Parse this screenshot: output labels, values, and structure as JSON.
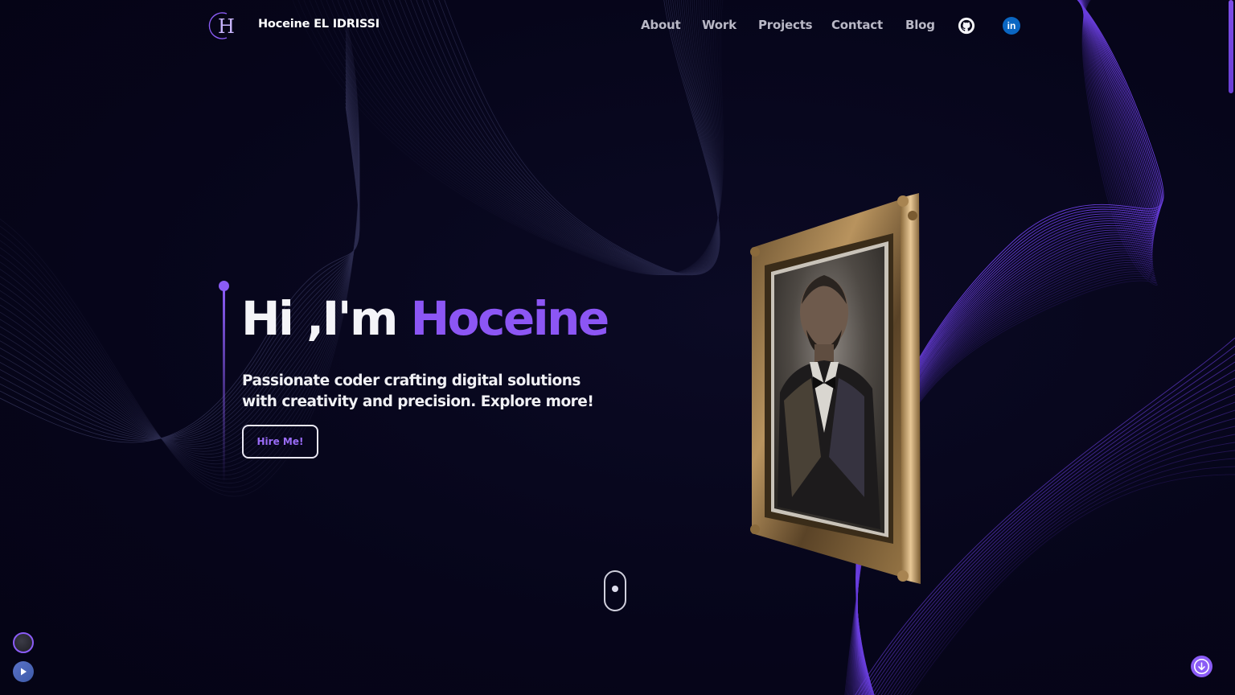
{
  "header": {
    "logo_letter": "H",
    "brand_name": "Hoceine EL IDRISSI",
    "nav": [
      {
        "label": "About"
      },
      {
        "label": "Work"
      },
      {
        "label": "Projects"
      },
      {
        "label": "Contact"
      },
      {
        "label": "Blog"
      }
    ],
    "social": [
      {
        "icon": "github-icon"
      },
      {
        "icon": "linkedin-icon",
        "text": "in"
      }
    ]
  },
  "hero": {
    "greeting": "Hi ,I'm ",
    "name": "Hoceine",
    "subtitle": "Passionate coder crafting digital solutions with creativity and precision. Explore more!",
    "cta_label": "Hire Me!"
  },
  "portrait": {
    "icon": "portrait-frame-image"
  },
  "scroll_indicator": {
    "icon": "mouse-scroll-icon"
  },
  "controls": {
    "theme_toggle_icon": "theme-orb-icon",
    "play_icon": "play-icon",
    "scroll_down_icon": "arrow-down-circle-icon"
  },
  "colors": {
    "background": "#07061a",
    "accent": "#8c56f4",
    "nav_text": "#b9b8c6",
    "linkedin": "#0a66c2"
  }
}
